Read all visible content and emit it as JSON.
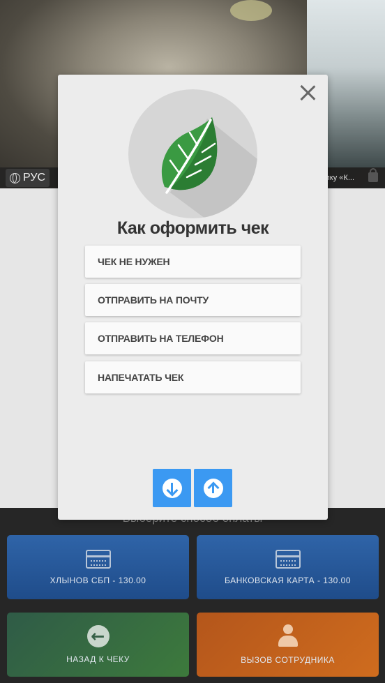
{
  "camera": {
    "language_label": "РУС",
    "hint_text": "опку «К..."
  },
  "payment": {
    "choose_label": "Выберите способ оплаты",
    "sbp_label": "ХЛЫНОВ СБП -  130.00",
    "card_label": "БАНКОВСКАЯ КАРТА -  130.00",
    "back_label": "НАЗАД К ЧЕКУ",
    "staff_label": "ВЫЗОВ СОТРУДНИКА"
  },
  "modal": {
    "title": "Как оформить чек",
    "options": [
      "ЧЕК НЕ НУЖЕН",
      "ОТПРАВИТЬ НА ПОЧТУ",
      "ОТПРАВИТЬ НА ТЕЛЕФОН",
      "НАПЕЧАТАТЬ ЧЕК"
    ]
  },
  "colors": {
    "accent_blue": "#3b99f2",
    "leaf_green": "#3a9a42"
  },
  "icons": [
    "globe-icon",
    "lock-icon",
    "close-icon",
    "leaf-logo",
    "card-icon",
    "back-arrow-icon",
    "staff-icon",
    "arrow-down-icon",
    "arrow-up-icon"
  ]
}
